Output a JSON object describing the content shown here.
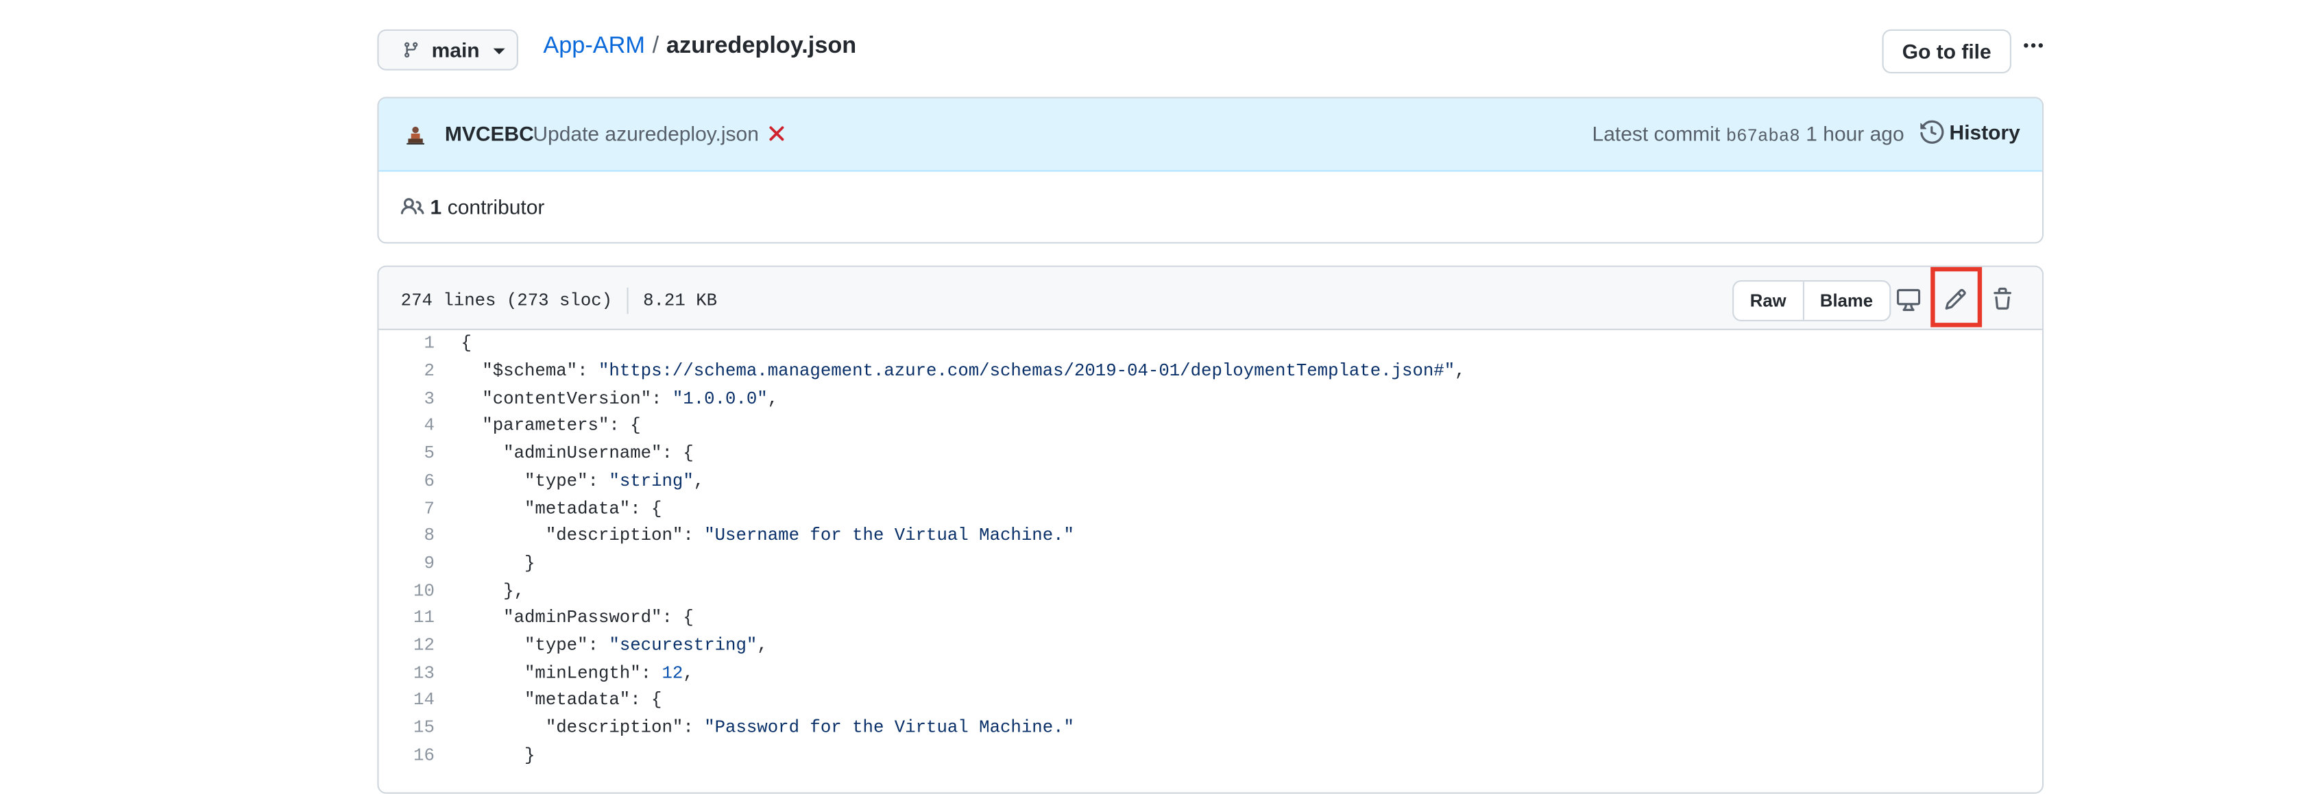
{
  "header": {
    "branch": "main",
    "repo": "App-ARM",
    "separator": "/",
    "file": "azuredeploy.json",
    "go_to_file": "Go to file"
  },
  "commit": {
    "author": "MVCEBC",
    "message": "Update azuredeploy.json",
    "latest_label": "Latest commit",
    "sha": "b67aba8",
    "time": "1 hour ago",
    "history": "History",
    "contributors_count": "1",
    "contributors_label": "contributor"
  },
  "file_info": {
    "lines": "274 lines (273 sloc)",
    "size": "8.21 KB",
    "raw": "Raw",
    "blame": "Blame"
  },
  "code_lines": [
    {
      "n": "1",
      "text": "{"
    },
    {
      "n": "2",
      "text": "  \"$schema\": \"https://schema.management.azure.com/schemas/2019-04-01/deploymentTemplate.json#\","
    },
    {
      "n": "3",
      "text": "  \"contentVersion\": \"1.0.0.0\","
    },
    {
      "n": "4",
      "text": "  \"parameters\": {"
    },
    {
      "n": "5",
      "text": "    \"adminUsername\": {"
    },
    {
      "n": "6",
      "text": "      \"type\": \"string\","
    },
    {
      "n": "7",
      "text": "      \"metadata\": {"
    },
    {
      "n": "8",
      "text": "        \"description\": \"Username for the Virtual Machine.\""
    },
    {
      "n": "9",
      "text": "      }"
    },
    {
      "n": "10",
      "text": "    },"
    },
    {
      "n": "11",
      "text": "    \"adminPassword\": {"
    },
    {
      "n": "12",
      "text": "      \"type\": \"securestring\","
    },
    {
      "n": "13",
      "text": "      \"minLength\": 12,"
    },
    {
      "n": "14",
      "text": "      \"metadata\": {"
    },
    {
      "n": "15",
      "text": "        \"description\": \"Password for the Virtual Machine.\""
    },
    {
      "n": "16",
      "text": "      }"
    }
  ],
  "icons": {
    "branch": "git-branch-icon",
    "kebab": "kebab-horizontal-icon",
    "avatar": "avatar-icon",
    "status": "x-icon",
    "history": "history-icon",
    "contributors": "people-icon",
    "display": "desktop-icon",
    "edit": "pencil-icon",
    "delete": "trash-icon"
  },
  "colors": {
    "link": "#0969da",
    "commit_bg": "#ddf4ff",
    "failure": "#cf222e",
    "highlight_box": "#e8382a",
    "string": "#0a3069",
    "number": "#0550ae"
  }
}
